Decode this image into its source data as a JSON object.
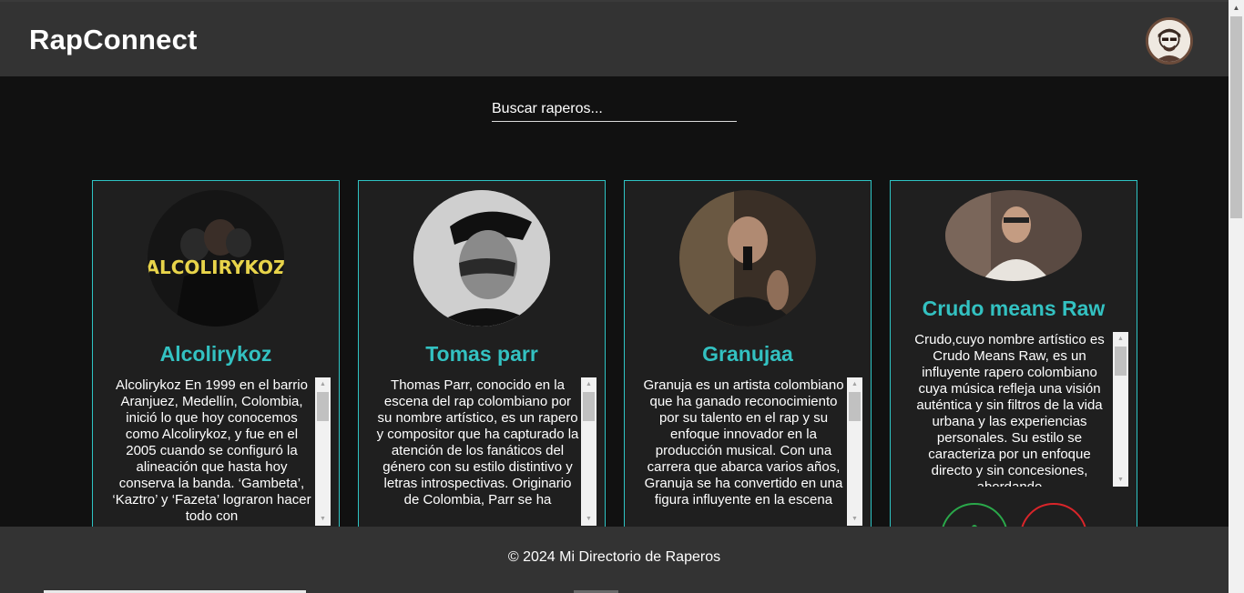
{
  "app": {
    "title": "RapConnect"
  },
  "search": {
    "placeholder": "Buscar raperos..."
  },
  "cards": [
    {
      "name": "Alcolirykoz",
      "bio": "Alcolirykoz En 1999 en el barrio Aranjuez, Medellín, Colombia, inició lo que hoy conocemos como Alcolirykoz, y fue en el 2005 cuando se configuró la alineación que hasta hoy conserva la banda. ‘Gambeta’, ‘Kaztro’ y ‘Fazeta’ lograron hacer todo con",
      "photo_text": "ALCOLIRYKOZ"
    },
    {
      "name": "Tomas parr",
      "bio": "Thomas Parr, conocido en la escena del rap colombiano por su nombre artístico, es un rapero y compositor que ha capturado la atención de los fanáticos del género con su estilo distintivo y letras introspectivas. Originario de Colombia, Parr se ha"
    },
    {
      "name": "Granujaa",
      "bio": "Granuja es un artista colombiano que ha ganado reconocimiento por su talento en el rap y su enfoque innovador en la producción musical. Con una carrera que abarca varios años, Granuja se ha convertido en una figura influyente en la escena"
    },
    {
      "name": "Crudo means Raw",
      "bio": "Crudo,cuyo nombre artístico es Crudo Means Raw, es un influyente rapero colombiano cuya música refleja una visión auténtica y sin filtros de la vida urbana y las experiencias personales. Su estilo se caracteriza por un enfoque directo y sin concesiones, abordando"
    }
  ],
  "footer": {
    "text": "© 2024 Mi Directorio de Raperos"
  },
  "colors": {
    "accent": "#33c1c1",
    "like": "#2aa84a",
    "dislike": "#d9252a",
    "header_bg": "#333333",
    "body_bg": "#111111"
  },
  "icons": {
    "profile": "user-avatar-icon",
    "like": "like-circle-icon",
    "dislike": "dislike-circle-icon"
  }
}
